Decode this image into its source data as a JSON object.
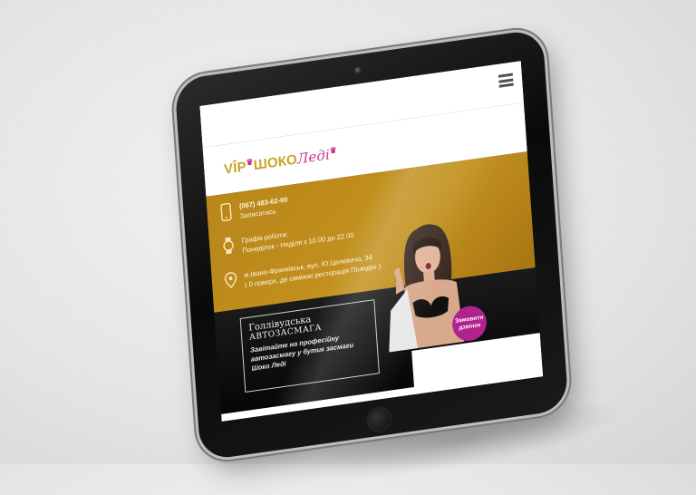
{
  "logo": {
    "vip": "VÎP",
    "shoko": "ШОКО",
    "ledi": "Леді"
  },
  "contact": {
    "phone": "(067) 483-62-00",
    "signup": "Записатись",
    "schedule_label": "Графік роботи:",
    "schedule_hours": "Понеділок - Неділя з 10.00 до 22.00",
    "address": "м.Івано-Франківськ, вул. Ю.Целевича, 34",
    "address_note": "( 0 поверх, де свміжжі ресторація Позидію )"
  },
  "hero": {
    "title_line1": "Голлівудська",
    "title_line2": "АВТОЗАСМАГА",
    "description": "Завітайте на професійну автозасмагу у бутик засмаги Шоко Леді",
    "callback_label": "Замовити дзвінок"
  },
  "colors": {
    "gold": "#c3921f",
    "magenta": "#b0238d",
    "logo_gold": "#c9a227",
    "logo_pink": "#c9318a"
  },
  "icons": {
    "menu": "hamburger-icon",
    "phone": "smartphone-icon",
    "clock": "watch-icon",
    "location": "map-pin-icon"
  }
}
